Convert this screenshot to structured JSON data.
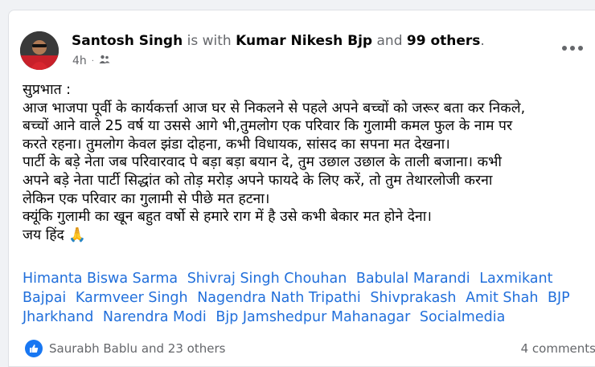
{
  "post": {
    "author": "Santosh Singh",
    "with_text": "is with",
    "tagged_person": "Kumar Nikesh Bjp",
    "and_text": "and",
    "others": "99 others",
    "period": ".",
    "time": "4h",
    "audience_icon": "friends-icon",
    "body_lines": [
      "सुप्रभात :",
      "आज भाजपा पूर्वी के कार्यकर्त्ता आज घर से निकलने से पहले अपने बच्चों को जरूर बता कर निकले,",
      " बच्चों आने वाले 25 वर्ष या उससे आगे भी,तुमलोग एक परिवार कि गुलामी कमल फुल के नाम पर",
      "करते रहना। तुमलोग केवल झंडा दोहना, कभी विधायक, सांसद का सपना मत देखना।",
      "पार्टी के बड़े नेता जब परिवारवाद पे बड़ा बड़ा बयान दे, तुम उछाल उछाल के ताली बजाना। कभी",
      "अपने बड़े नेता पार्टी सिद्धांत को तोड़ मरोड़ अपने फायदे के लिए करें, तो तुम तेथारलोजी करना",
      "लेकिन एक परिवार का गुलामी से पीछे मत हटना।",
      "क्यूंकि गुलामी का खून बहुत वर्षो से हमारे राग में है उसे कभी बेकार मत होने देना।",
      "जय हिंद 🙏"
    ],
    "tags": [
      "Himanta Biswa Sarma",
      "Shivraj Singh Chouhan",
      "Babulal Marandi",
      "Laxmikant Bajpai",
      "Karmveer Singh",
      "Nagendra Nath Tripathi",
      "Shivprakash",
      "Amit Shah",
      "BJP Jharkhand",
      "Narendra Modi",
      "Bjp Jamshedpur Mahanagar",
      "Socialmedia"
    ],
    "reactions_text": "Saurabh Bablu and 23 others",
    "comments_text": "4 comments"
  },
  "colors": {
    "link": "#216fdb",
    "muted": "#65676b",
    "like_blue": "#1877f2"
  }
}
